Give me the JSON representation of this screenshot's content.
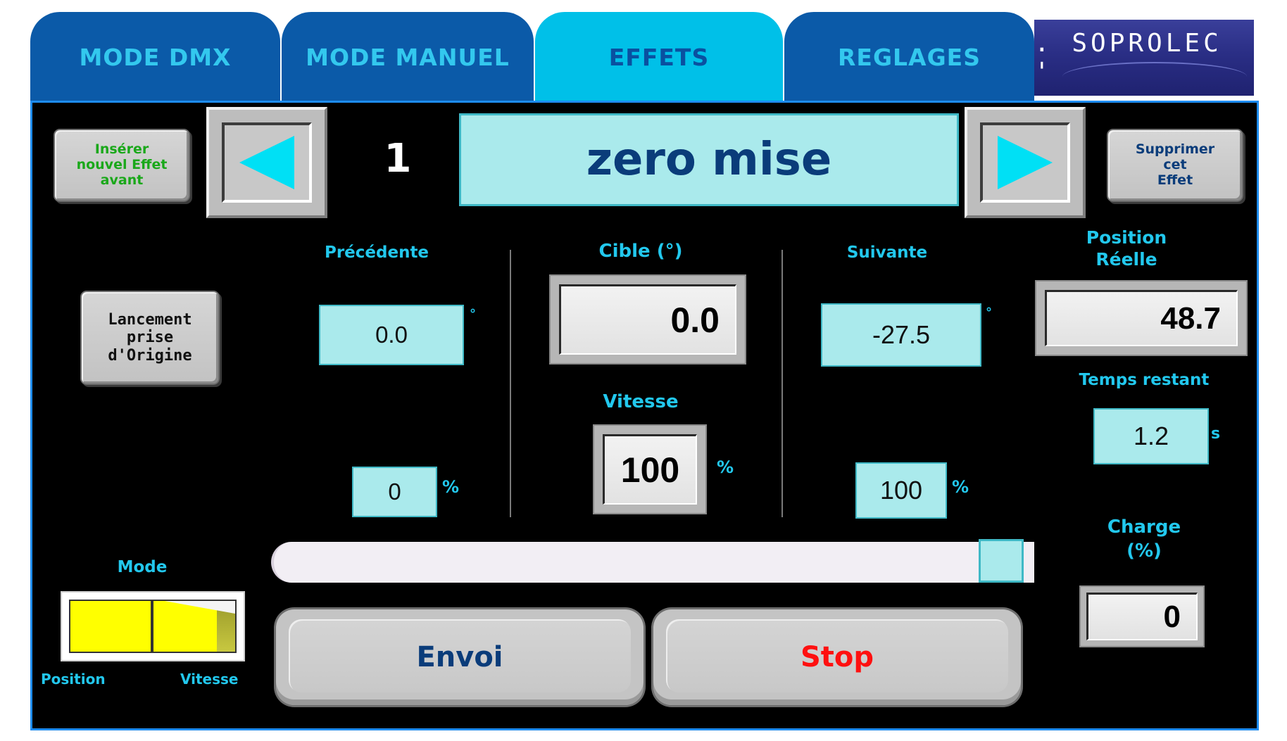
{
  "tabs": [
    {
      "label": "MODE DMX",
      "active": false
    },
    {
      "label": "MODE MANUEL",
      "active": false
    },
    {
      "label": "EFFETS",
      "active": true
    },
    {
      "label": "REGLAGES",
      "active": false
    }
  ],
  "logo": {
    "text": ". SOPROLEC '"
  },
  "effect": {
    "insert_line1": "Insérer",
    "insert_line2": "nouvel Effet",
    "insert_line3": "avant",
    "number": "1",
    "name": "zero mise",
    "delete_line1": "Supprimer",
    "delete_line2": "cet",
    "delete_line3": "Effet"
  },
  "origin_button": {
    "line1": "Lancement",
    "line2": "prise",
    "line3": "d'Origine"
  },
  "previous": {
    "label": "Précédente",
    "angle": "0.0",
    "angle_unit": "°",
    "speed": "0",
    "speed_unit": "%"
  },
  "target": {
    "label": "Cible (°)",
    "angle": "0.0",
    "speed_label": "Vitesse",
    "speed": "100",
    "speed_unit": "%"
  },
  "next": {
    "label": "Suivante",
    "angle": "-27.5",
    "angle_unit": "°",
    "speed": "100",
    "speed_unit": "%"
  },
  "position": {
    "label_line1": "Position",
    "label_line2": "Réelle",
    "value": "48.7"
  },
  "remaining": {
    "label": "Temps restant",
    "value": "1.2",
    "unit": "s"
  },
  "load": {
    "label_line1": "Charge",
    "label_line2": "(%)",
    "value": "0"
  },
  "slider": {
    "value_fraction": 1.0
  },
  "mode": {
    "label": "Mode",
    "left_label": "Position",
    "right_label": "Vitesse"
  },
  "actions": {
    "send": "Envoi",
    "stop": "Stop"
  },
  "colors": {
    "tab_inactive": "#0b5aa8",
    "tab_active": "#00c0e8",
    "accent": "#22c8ee",
    "value_box": "#aaeaec",
    "stop": "#ff1010",
    "send": "#0a3c7a",
    "insert_text": "#1aa81a"
  }
}
